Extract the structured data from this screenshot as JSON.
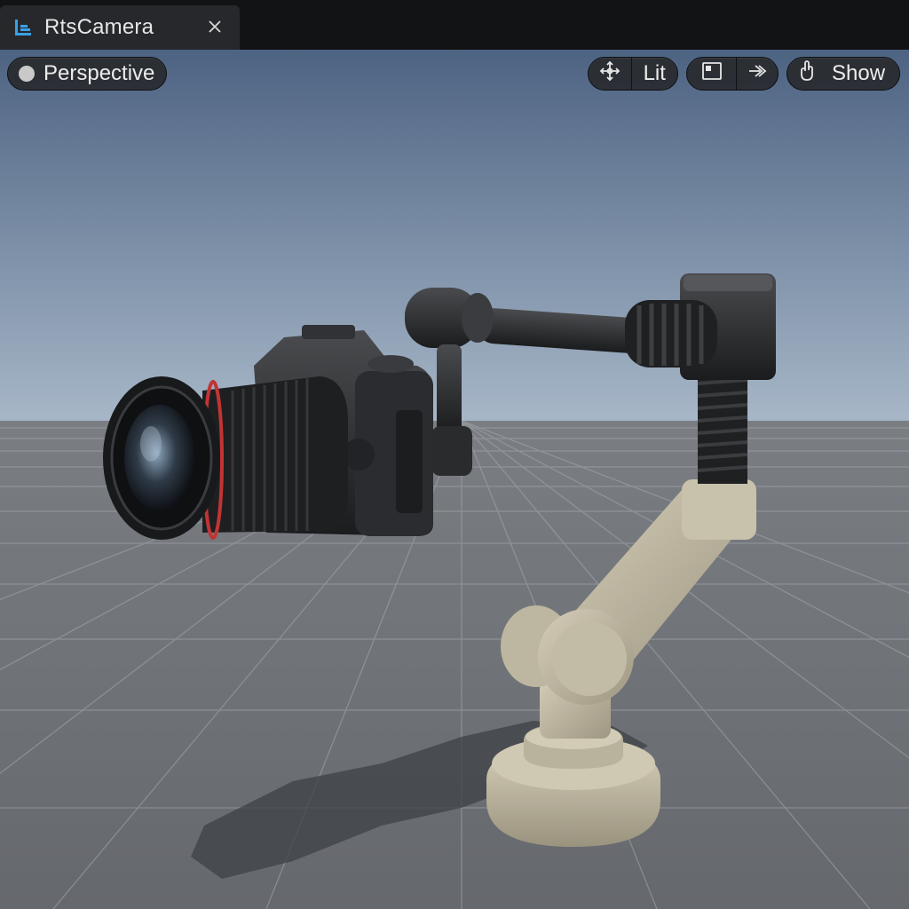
{
  "tab": {
    "title": "RtsCamera",
    "icon": "blueprint-icon",
    "close_icon": "close-icon"
  },
  "viewport": {
    "mode_label": "Perspective",
    "lighting_label": "Lit",
    "show_label": "Show",
    "icons": [
      "move-gizmo-icon",
      "viewport-layout-icon",
      "camera-speed-icon",
      "hand-pointer-icon"
    ]
  },
  "colors": {
    "sky_top": "#4d6382",
    "sky_horizon": "#a2b3c6",
    "floor": "#6f7378",
    "arm": "#bdb6a1",
    "camera_body": "#2a2b2d",
    "lens_ring": "#c23434"
  }
}
